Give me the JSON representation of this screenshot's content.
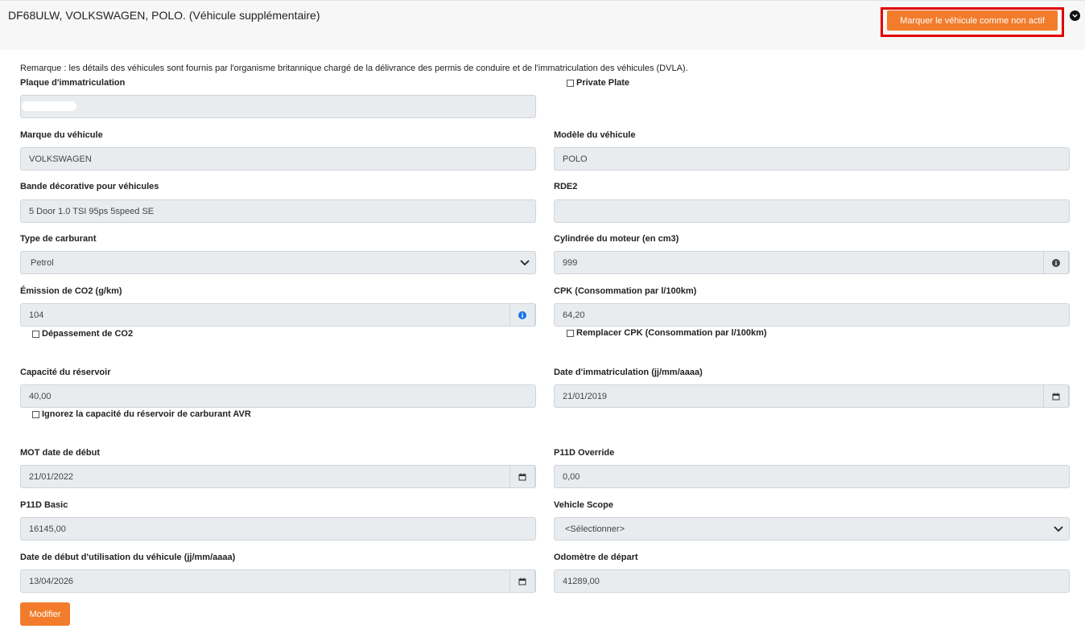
{
  "header": {
    "title": "DF68ULW, VOLKSWAGEN, POLO. (Véhicule supplémentaire)",
    "inactive_button": "Marquer le véhicule comme non actif",
    "collapse_icon": "chevron-down-circle-icon"
  },
  "remark": "Remarque : les détails des véhicules sont fournis par l'organisme britannique chargé de la délivrance des permis de conduire et de l'immatriculation des véhicules (DVLA).",
  "fields": {
    "plate": {
      "label": "Plaque d'immatriculation",
      "value": ""
    },
    "private_plate": {
      "label": "Private Plate",
      "checked": false
    },
    "make": {
      "label": "Marque du véhicule",
      "value": "VOLKSWAGEN"
    },
    "model": {
      "label": "Modèle du véhicule",
      "value": "POLO"
    },
    "trim": {
      "label": "Bande décorative pour véhicules",
      "value": "5 Door 1.0 TSI 95ps 5speed SE"
    },
    "rde2": {
      "label": "RDE2",
      "value": ""
    },
    "fuel": {
      "label": "Type de carburant",
      "value": "Petrol"
    },
    "engine": {
      "label": "Cylindrée du moteur (en cm3)",
      "value": "999"
    },
    "co2": {
      "label": "Émission de CO2 (g/km)",
      "value": "104"
    },
    "co2_exceed": {
      "label": "Dépassement de CO2",
      "checked": false
    },
    "cpk": {
      "label": "CPK (Consommation par l/100km)",
      "value": "64,20"
    },
    "cpk_override": {
      "label": "Remplacer CPK (Consommation par l/100km)",
      "checked": false
    },
    "tank": {
      "label": "Capacité du réservoir",
      "value": "40,00"
    },
    "tank_ignore": {
      "label": "Ignorez la capacité du réservoir de carburant AVR",
      "checked": false
    },
    "reg_date": {
      "label": "Date d'immatriculation (jj/mm/aaaa)",
      "value": "21/01/2019"
    },
    "mot_date": {
      "label": "MOT date de début",
      "value": "21/01/2022"
    },
    "p11d_override": {
      "label": "P11D Override",
      "value": "0,00"
    },
    "p11d_basic": {
      "label": "P11D Basic",
      "value": "16145,00"
    },
    "scope": {
      "label": "Vehicle Scope",
      "value": "<Sélectionner>"
    },
    "use_date": {
      "label": "Date de début d'utilisation du véhicule (jj/mm/aaaa)",
      "value": "13/04/2026"
    },
    "odometer": {
      "label": "Odomètre de départ",
      "value": "41289,00"
    }
  },
  "modify_button": "Modifier",
  "colors": {
    "accent": "#f27c2b",
    "highlight": "#e00000",
    "field_bg": "#e9ecef",
    "info": "#1a73e8"
  }
}
